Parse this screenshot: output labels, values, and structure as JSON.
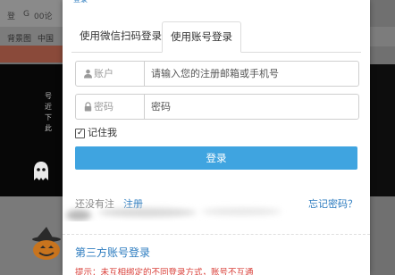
{
  "background": {
    "topbar_items": [
      "登",
      "G",
      "00论"
    ],
    "nav_items": [
      "背景图",
      "中国"
    ],
    "dark_text": [
      "号",
      "近",
      "下",
      "此"
    ]
  },
  "modal": {
    "top_fragment": "登录",
    "tabs": [
      {
        "label": "使用微信扫码登录",
        "active": false
      },
      {
        "label": "使用账号登录",
        "active": true
      }
    ],
    "account": {
      "label": "账户",
      "placeholder": "请输入您的注册邮箱或手机号",
      "value": "",
      "icon": "user-icon"
    },
    "password": {
      "label": "密码",
      "placeholder": "密码",
      "value": "",
      "icon": "lock-icon"
    },
    "remember": {
      "label": "记住我",
      "checked": true
    },
    "login_button": "登录",
    "no_account_text": "还没有注",
    "register_link": "注册",
    "forgot_link": "忘记密码？",
    "third_party_title": "第三方账号登录",
    "tip": "提示：未互相绑定的不同登录方式，账号不互通"
  },
  "colors": {
    "accent": "#3fa4e0",
    "link": "#2b7bbf",
    "tip": "#d9403a",
    "overlay": "#6e6e6e"
  }
}
